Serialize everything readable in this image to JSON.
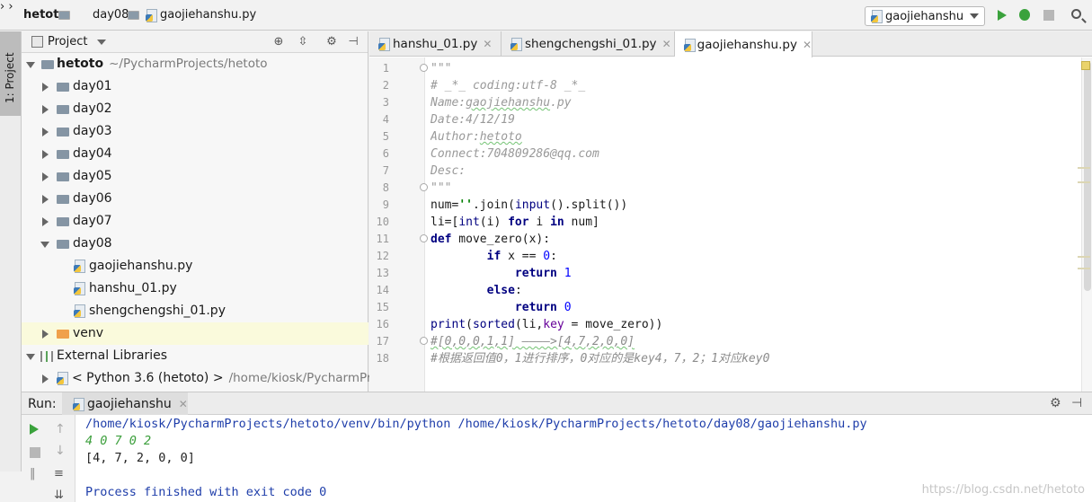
{
  "navbar": {
    "breadcrumb": [
      "hetoto",
      "day08",
      "gaojiehanshu.py"
    ],
    "run_config": "gaojiehanshu"
  },
  "left_stripe": {
    "project_tab": "1: Project"
  },
  "project_panel": {
    "title": "Project",
    "tree": [
      {
        "label": "hetoto",
        "sub": "~/PycharmProjects/hetoto",
        "kind": "root"
      },
      {
        "label": "day01",
        "kind": "dir"
      },
      {
        "label": "day02",
        "kind": "dir"
      },
      {
        "label": "day03",
        "kind": "dir"
      },
      {
        "label": "day04",
        "kind": "dir"
      },
      {
        "label": "day05",
        "kind": "dir"
      },
      {
        "label": "day06",
        "kind": "dir"
      },
      {
        "label": "day07",
        "kind": "dir"
      },
      {
        "label": "day08",
        "kind": "dir-open"
      },
      {
        "label": "gaojiehanshu.py",
        "kind": "file"
      },
      {
        "label": "hanshu_01.py",
        "kind": "file"
      },
      {
        "label": "shengchengshi_01.py",
        "kind": "file"
      },
      {
        "label": "venv",
        "kind": "venv"
      },
      {
        "label": "External Libraries",
        "kind": "libs"
      },
      {
        "label": "< Python 3.6 (hetoto) >",
        "sub": "/home/kiosk/PycharmPro",
        "kind": "python"
      }
    ]
  },
  "editor": {
    "tabs": [
      {
        "label": "hanshu_01.py",
        "active": false
      },
      {
        "label": "shengchengshi_01.py",
        "active": false
      },
      {
        "label": "gaojiehanshu.py",
        "active": true
      }
    ],
    "line_numbers": [
      "1",
      "2",
      "3",
      "4",
      "5",
      "6",
      "7",
      "8",
      "9",
      "10",
      "11",
      "12",
      "13",
      "14",
      "15",
      "16",
      "17",
      "18"
    ],
    "lines": {
      "l1": "\"\"\"",
      "l2": "# _*_ coding:utf-8 _*_",
      "l3a": "Name:",
      "l3b": "gaojiehanshu",
      "l3c": ".py",
      "l4": "Date:4/12/19",
      "l5a": "Author:",
      "l5b": "hetoto",
      "l6": "Connect:704809286@qq.com",
      "l7": "Desc:",
      "l8": "\"\"\"",
      "l9a": "num=",
      "l9b": "''",
      "l9c": ".join(",
      "l9d": "input",
      "l9e": "().split())",
      "l10a": "li=[",
      "l10b": "int",
      "l10c": "(i) ",
      "l10d": "for",
      "l10e": " i ",
      "l10f": "in",
      "l10g": " num]",
      "l11a": "def",
      "l11b": " move_zero(x):",
      "l12a": "        ",
      "l12b": "if",
      "l12c": " x == ",
      "l12d": "0",
      "l12e": ":",
      "l13a": "            ",
      "l13b": "return",
      "l13c": " ",
      "l13d": "1",
      "l14a": "        ",
      "l14b": "else",
      "l14c": ":",
      "l15a": "            ",
      "l15b": "return",
      "l15c": " ",
      "l15d": "0",
      "l16a": "print",
      "l16b": "(",
      "l16c": "sorted",
      "l16d": "(li,",
      "l16e": "key",
      "l16f": " = move_zero))",
      "l17": "#[0,0,0,1,1] ————>[4,7,2,0,0]",
      "l18": "#根据返回值0，1进行排序，0对应的是key4，7，2；1对应key0"
    }
  },
  "run_panel": {
    "label": "Run:",
    "tab": "gaojiehanshu",
    "output": {
      "cmd": "/home/kiosk/PycharmProjects/hetoto/venv/bin/python /home/kiosk/PycharmProjects/hetoto/day08/gaojiehanshu.py",
      "input": "4 0 7 0 2",
      "result": "[4, 7, 2, 0, 0]",
      "exit": "Process finished with exit code 0"
    }
  },
  "watermark": "https://blog.csdn.net/hetoto"
}
